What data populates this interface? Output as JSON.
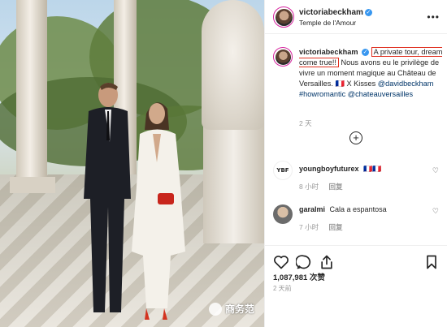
{
  "header": {
    "username": "victoriabeckham",
    "location": "Temple de l'Amour",
    "verified_icon": "verified-badge-icon",
    "more_icon": "ellipsis-icon"
  },
  "caption": {
    "username": "victoriabeckham",
    "highlight": "A private tour, dream come true!!",
    "text": "Nous avons eu le privilège de vivre un moment magique au Château de Versailles.",
    "flag": "🇫🇷",
    "x": "X",
    "kisses": "Kisses",
    "mention1": "@davidbeckham",
    "hashtag": "#howromantic",
    "mention2": "@chateauversailles",
    "time": "2 天"
  },
  "load_more_icon": "plus-circle-icon",
  "comments": [
    {
      "avatar_text": "YBF",
      "username": "youngboyfuturex",
      "flag": "🇫🇷🇫🇷",
      "time": "8 小时",
      "reply": "回复"
    },
    {
      "username": "garalmi",
      "text": "Cala a espantosa",
      "time": "7 小时",
      "reply": "回复"
    }
  ],
  "likes": "1,087,981 次赞",
  "post_time": "2 天前",
  "watermark": "商务范",
  "colors": {
    "highlight_border": "#e03020",
    "link": "#003569",
    "verified": "#3897f0",
    "muted": "#999999"
  }
}
